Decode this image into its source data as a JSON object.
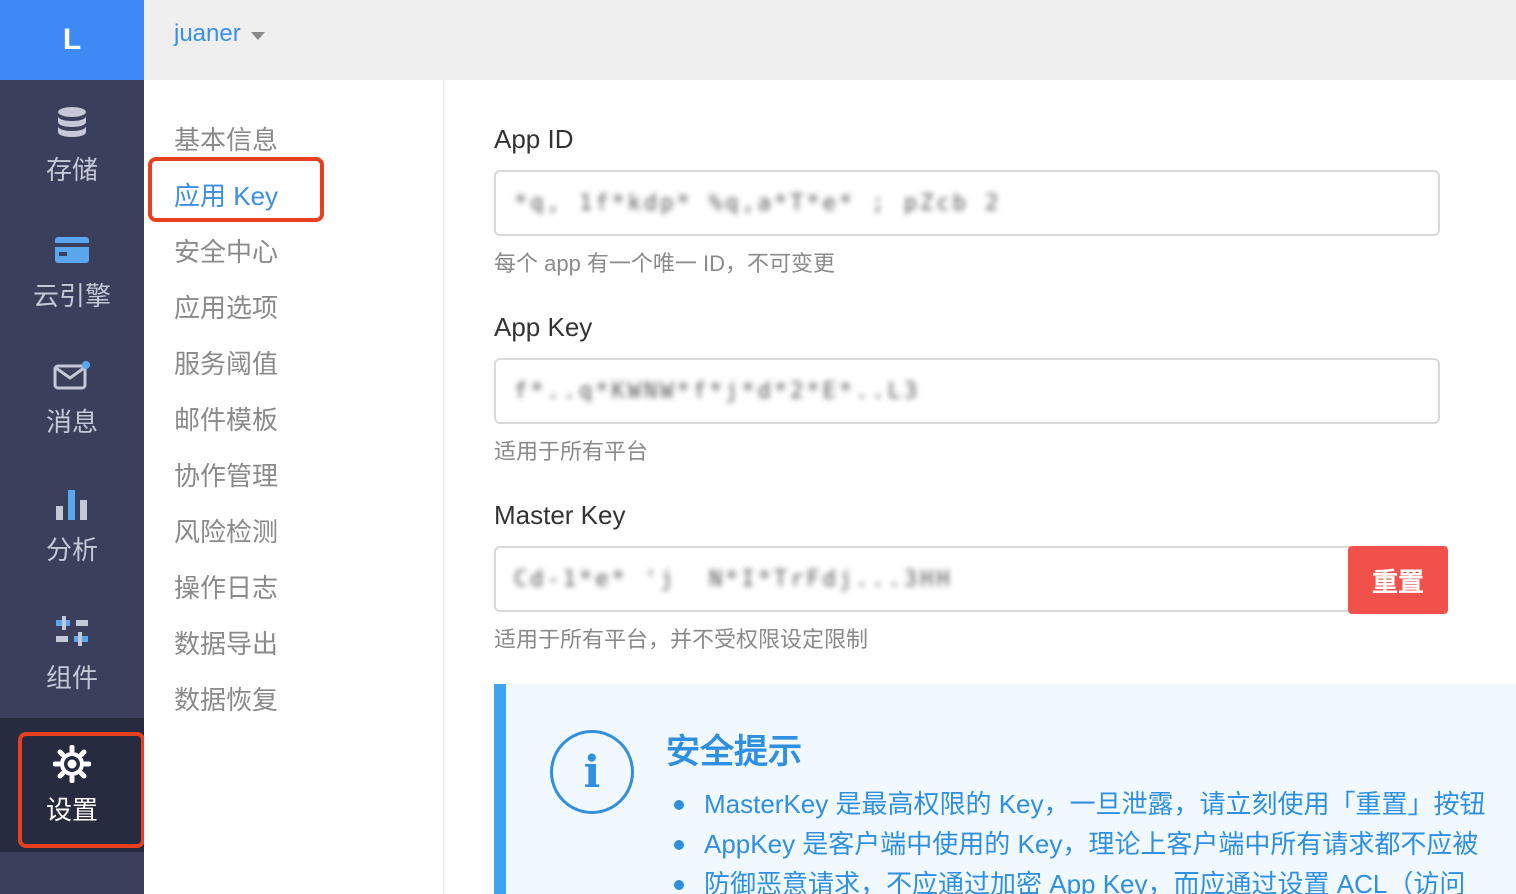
{
  "rail": {
    "logo": "L",
    "items": [
      {
        "label": "存储",
        "icon": "database-icon"
      },
      {
        "label": "云引擎",
        "icon": "cloud-engine-icon"
      },
      {
        "label": "消息",
        "icon": "message-icon"
      },
      {
        "label": "分析",
        "icon": "bar-chart-icon"
      },
      {
        "label": "组件",
        "icon": "components-icon"
      },
      {
        "label": "设置",
        "icon": "gear-icon",
        "active": true
      }
    ]
  },
  "topbar": {
    "app_name": "juaner"
  },
  "submenu": {
    "items": [
      "基本信息",
      "应用 Key",
      "安全中心",
      "应用选项",
      "服务阈值",
      "邮件模板",
      "协作管理",
      "风险检测",
      "操作日志",
      "数据导出",
      "数据恢复"
    ],
    "active": "应用 Key"
  },
  "fields": {
    "app_id": {
      "label": "App ID",
      "value": "*q, 1f*kdp* %q,a*T*e* ; pZcb 2",
      "help": "每个 app 有一个唯一 ID，不可变更"
    },
    "app_key": {
      "label": "App Key",
      "value": "f*..q*KWNW*f*j*d*2*E*..L3",
      "help": "适用于所有平台"
    },
    "master_key": {
      "label": "Master Key",
      "value": "Cd-1*e* 'j  N*I*TrFdj...3HH",
      "help": "适用于所有平台，并不受权限设定限制",
      "reset_label": "重置"
    }
  },
  "notice": {
    "title": "安全提示",
    "icon": "info-icon",
    "items": [
      "MasterKey 是最高权限的 Key，一旦泄露，请立刻使用「重置」按钮",
      "AppKey 是客户端中使用的 Key，理论上客户端中所有请求都不应被",
      "防御恶意请求，不应通过加密 App Key，而应通过设置 ACL（访问"
    ]
  },
  "colors": {
    "accent": "#3b8fe6",
    "rail_bg": "#3a3f5c",
    "danger": "#f2504b",
    "highlight_box": "#e8401f"
  }
}
